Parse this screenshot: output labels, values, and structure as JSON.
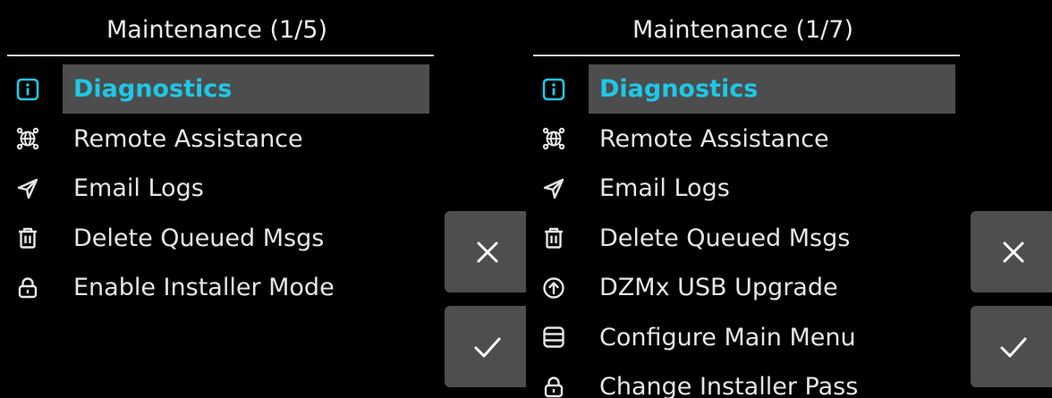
{
  "colors": {
    "background": "#000000",
    "selected_row_bg": "#4d4d4d",
    "selected_text": "#1ec8e6",
    "text": "#e6e6e6",
    "button_bg": "#4e4e4e"
  },
  "screens": [
    {
      "title": "Maintenance (1/5)",
      "items": [
        {
          "label": "Diagnostics",
          "icon": "info-icon",
          "selected": true
        },
        {
          "label": "Remote Assistance",
          "icon": "globe-network-icon",
          "selected": false
        },
        {
          "label": "Email Logs",
          "icon": "send-icon",
          "selected": false
        },
        {
          "label": "Delete Queued Msgs",
          "icon": "trash-icon",
          "selected": false
        },
        {
          "label": "Enable Installer Mode",
          "icon": "lock-icon",
          "selected": false
        }
      ],
      "cancel_icon": "close-icon",
      "confirm_icon": "check-icon"
    },
    {
      "title": "Maintenance (1/7)",
      "items": [
        {
          "label": "Diagnostics",
          "icon": "info-icon",
          "selected": true
        },
        {
          "label": "Remote Assistance",
          "icon": "globe-network-icon",
          "selected": false
        },
        {
          "label": "Email Logs",
          "icon": "send-icon",
          "selected": false
        },
        {
          "label": "Delete Queued Msgs",
          "icon": "trash-icon",
          "selected": false
        },
        {
          "label": "DZMx USB Upgrade",
          "icon": "upload-icon",
          "selected": false
        },
        {
          "label": "Configure Main Menu",
          "icon": "list-icon",
          "selected": false
        },
        {
          "label": "Change Installer Pass",
          "icon": "lock-icon",
          "selected": false
        }
      ],
      "cancel_icon": "close-icon",
      "confirm_icon": "check-icon"
    }
  ]
}
